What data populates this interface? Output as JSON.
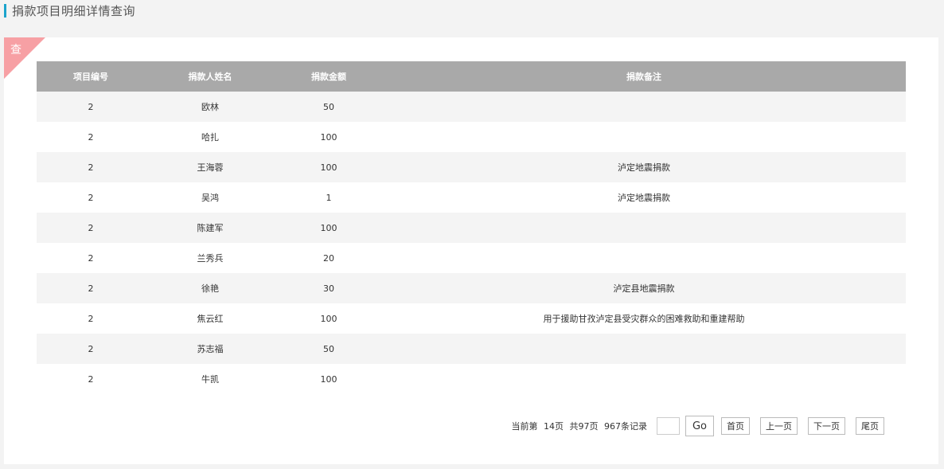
{
  "page": {
    "title": "捐款项目明细详情查询"
  },
  "panel": {
    "corner_label": "查"
  },
  "table": {
    "headers": [
      "项目编号",
      "捐款人姓名",
      "捐款金额",
      "捐款备注"
    ],
    "rows": [
      [
        "2",
        "欧林",
        "50",
        ""
      ],
      [
        "2",
        "哈扎",
        "100",
        ""
      ],
      [
        "2",
        "王海蓉",
        "100",
        "泸定地震捐款"
      ],
      [
        "2",
        "吴鸿",
        "1",
        "泸定地震捐款"
      ],
      [
        "2",
        "陈建军",
        "100",
        ""
      ],
      [
        "2",
        "兰秀兵",
        "20",
        ""
      ],
      [
        "2",
        "徐艳",
        "30",
        "泸定县地震捐款"
      ],
      [
        "2",
        "焦云红",
        "100",
        "用于援助甘孜泸定县受灾群众的困难救助和重建帮助"
      ],
      [
        "2",
        "苏志福",
        "50",
        ""
      ],
      [
        "2",
        "牛凯",
        "100",
        ""
      ]
    ]
  },
  "pager": {
    "current_prefix": "当前第",
    "current_page": "14页",
    "total_pages": "共97页",
    "total_records": "967条记录",
    "jump_value": "",
    "go_label": "Go",
    "first_label": "首页",
    "prev_label": "上一页",
    "next_label": "下一页",
    "last_label": "尾页"
  },
  "colors": {
    "accent": "#1da4cc",
    "header_bg": "#a9a9a9",
    "corner_tag": "#f7a0a4",
    "row_alt": "#f4f4f4"
  }
}
